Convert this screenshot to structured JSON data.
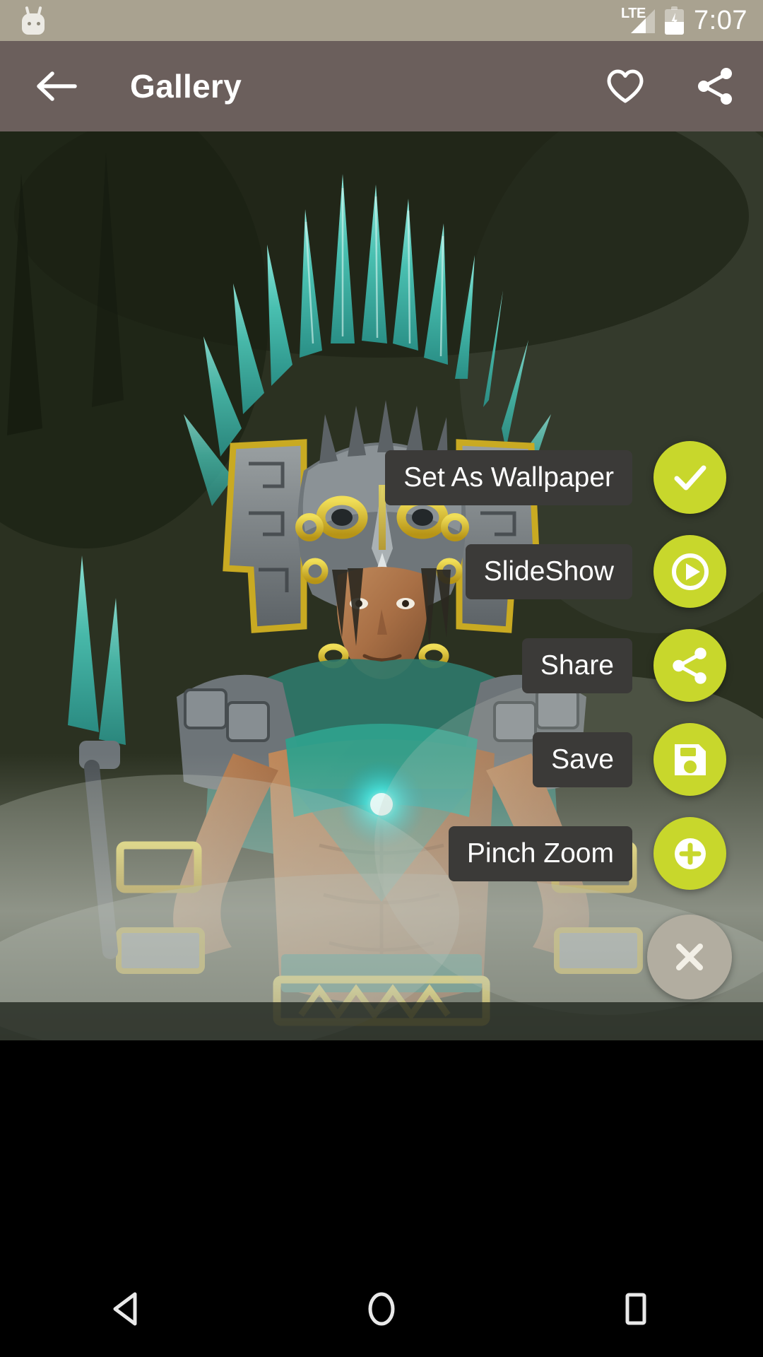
{
  "status_bar": {
    "notification_icon": "android-marshmallow-icon",
    "network_type": "LTE",
    "signal_icon": "signal-bars-icon",
    "battery_icon": "battery-charging-icon",
    "time": "7:07",
    "background_color": "#a9a290",
    "text_color": "#ffffff"
  },
  "toolbar": {
    "back_icon": "arrow-left-icon",
    "title": "Gallery",
    "favorite_icon": "heart-outline-icon",
    "share_icon": "share-nodes-icon",
    "background_color": "#6b5f5c",
    "text_color": "#ffffff"
  },
  "photo": {
    "description": "Aztec warrior with teal feather headdress and gold ornaments in misty forest"
  },
  "fab_menu": {
    "accent_color": "#c8d72c",
    "close_color": "#b2ada0",
    "label_background": "#3b3a38",
    "label_text_color": "#ffffff",
    "items": [
      {
        "label": "Set As Wallpaper",
        "icon": "check-icon"
      },
      {
        "label": "SlideShow",
        "icon": "play-circle-icon"
      },
      {
        "label": "Share",
        "icon": "share-nodes-icon"
      },
      {
        "label": "Save",
        "icon": "floppy-disk-icon"
      },
      {
        "label": "Pinch Zoom",
        "icon": "plus-circle-icon"
      }
    ],
    "close": {
      "label": "Close",
      "icon": "close-icon"
    }
  },
  "nav_bar": {
    "background_color": "#000000",
    "buttons": [
      {
        "name": "back",
        "icon": "triangle-back-icon"
      },
      {
        "name": "home",
        "icon": "circle-home-icon"
      },
      {
        "name": "recents",
        "icon": "square-recents-icon"
      }
    ]
  }
}
